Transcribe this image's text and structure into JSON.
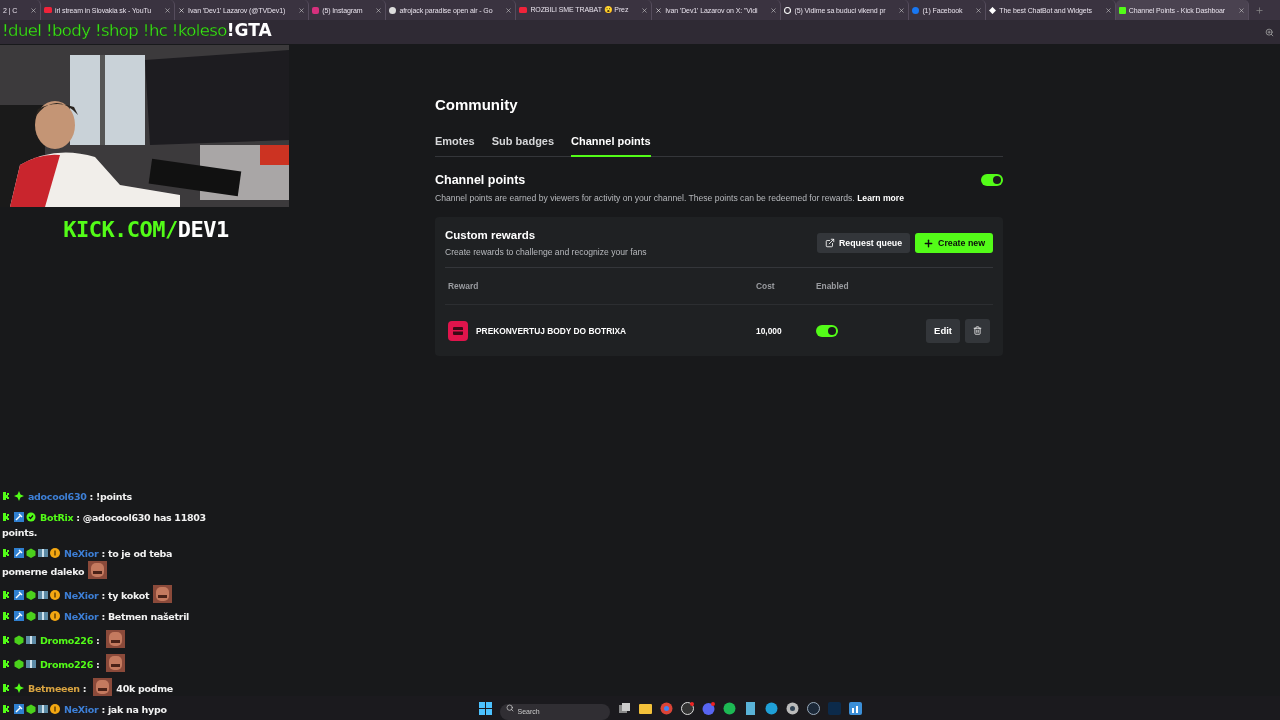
{
  "browser": {
    "tabs": [
      {
        "title": "2 | C",
        "selected": false
      },
      {
        "title": "irl stream in Slovakia sk - YouTu",
        "selected": false
      },
      {
        "title": "Ivan 'Dev1' Lazarov (@TVDev1)",
        "selected": false
      },
      {
        "title": "(5) Instagram",
        "selected": false
      },
      {
        "title": "afrojack paradise open air - Go",
        "selected": false
      },
      {
        "title": "ROZBILI SME TRABAT 😮 Prez",
        "selected": false
      },
      {
        "title": "Ivan 'Dev1' Lazarov on X: \"Vidi",
        "selected": false
      },
      {
        "title": "(5) Vidime sa buduci vikend pr",
        "selected": false
      },
      {
        "title": "(1) Facebook",
        "selected": false
      },
      {
        "title": "The best ChatBot and Widgets",
        "selected": false
      },
      {
        "title": "Channel Points - Kick Dashboar",
        "selected": true
      }
    ]
  },
  "overlay": {
    "commands": "!duel !body !shop !hc !koleso",
    "highlight": "!GTA",
    "logo_accent": "KICK.COM/",
    "logo_rest": "DEV1",
    "chat": [
      {
        "badges": [
          {
            "kind": "kick"
          },
          {
            "kind": "diamond"
          }
        ],
        "user": "adocool630",
        "color": "#3d7fd6",
        "separator": ":",
        "segments": [
          {
            "kind": "text",
            "text": "!points"
          }
        ]
      },
      {
        "badges": [
          {
            "kind": "kick"
          },
          {
            "kind": "hammer"
          },
          {
            "kind": "check"
          }
        ],
        "user": "BotRix",
        "color": "#53fc18",
        "separator": ":",
        "segments": [
          {
            "kind": "text",
            "text": "@adocool630 has 11803 points."
          }
        ]
      },
      {
        "badges": [
          {
            "kind": "kick"
          },
          {
            "kind": "hammer"
          },
          {
            "kind": "cube"
          },
          {
            "kind": "gift"
          },
          {
            "kind": "coin"
          }
        ],
        "user": "NeXior",
        "color": "#3d7fd6",
        "separator": ":",
        "segments": [
          {
            "kind": "text",
            "text": "to je od teba pomerne daleko"
          },
          {
            "kind": "emote"
          }
        ]
      },
      {
        "badges": [
          {
            "kind": "kick"
          },
          {
            "kind": "hammer"
          },
          {
            "kind": "cube"
          },
          {
            "kind": "gift"
          },
          {
            "kind": "coin"
          }
        ],
        "user": "NeXior",
        "color": "#3d7fd6",
        "separator": ":",
        "segments": [
          {
            "kind": "text",
            "text": "ty kokot"
          },
          {
            "kind": "emote"
          }
        ]
      },
      {
        "badges": [
          {
            "kind": "kick"
          },
          {
            "kind": "hammer"
          },
          {
            "kind": "cube"
          },
          {
            "kind": "gift"
          },
          {
            "kind": "coin"
          }
        ],
        "user": "NeXior",
        "color": "#3d7fd6",
        "separator": ":",
        "segments": [
          {
            "kind": "text",
            "text": "Betmen našetril"
          }
        ]
      },
      {
        "badges": [
          {
            "kind": "kick"
          },
          {
            "kind": "cube"
          },
          {
            "kind": "gift"
          }
        ],
        "user": "Dromo226",
        "color": "#53fc18",
        "separator": ":",
        "segments": [
          {
            "kind": "emote"
          }
        ]
      },
      {
        "badges": [
          {
            "kind": "kick"
          },
          {
            "kind": "cube"
          },
          {
            "kind": "gift"
          }
        ],
        "user": "Dromo226",
        "color": "#53fc18",
        "separator": ":",
        "segments": [
          {
            "kind": "emote"
          }
        ]
      },
      {
        "badges": [
          {
            "kind": "kick"
          },
          {
            "kind": "diamond"
          }
        ],
        "user": "Betmeeen",
        "color": "#d9a441",
        "separator": ":",
        "segments": [
          {
            "kind": "emote"
          },
          {
            "kind": "text",
            "text": "40k podme"
          }
        ]
      },
      {
        "badges": [
          {
            "kind": "kick"
          },
          {
            "kind": "hammer"
          },
          {
            "kind": "cube"
          },
          {
            "kind": "gift"
          },
          {
            "kind": "coin"
          }
        ],
        "user": "NeXior",
        "color": "#3d7fd6",
        "separator": ":",
        "segments": [
          {
            "kind": "text",
            "text": "jak na hypo"
          }
        ]
      }
    ]
  },
  "page": {
    "title": "Community",
    "tabs": [
      {
        "label": "Emotes",
        "selected": false
      },
      {
        "label": "Sub badges",
        "selected": false
      },
      {
        "label": "Channel points",
        "selected": true
      }
    ],
    "section": {
      "title": "Channel points",
      "on": true,
      "description": "Channel points are earned by viewers for activity on your channel. These points can be redeemed for rewards.",
      "link": "Learn more"
    },
    "rewards": {
      "title": "Custom rewards",
      "subtitle": "Create rewards to challenge and recognize your fans",
      "queue_button": "Request queue",
      "create_button": "Create new",
      "columns": [
        "Reward",
        "Cost",
        "Enabled"
      ],
      "rows": [
        {
          "name": "PREKONVERTUJ BODY DO BOTRIXA",
          "cost": "10,000",
          "enabled": true,
          "edit": "Edit"
        }
      ]
    }
  },
  "taskbar": {
    "search": {
      "placeholder": "Search"
    }
  }
}
